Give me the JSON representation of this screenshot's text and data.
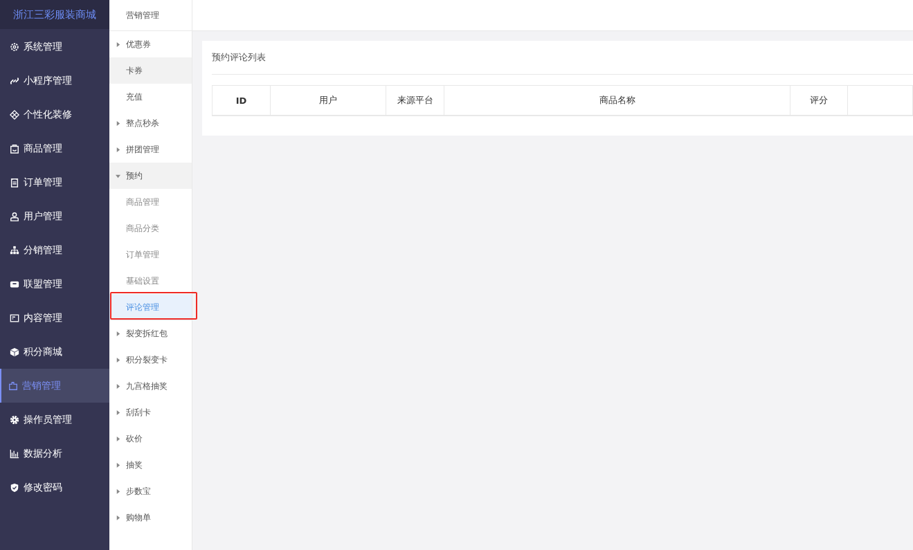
{
  "brand": "浙江三彩服装商城",
  "nav": [
    {
      "label": "系统管理",
      "selected": false
    },
    {
      "label": "小程序管理",
      "selected": false
    },
    {
      "label": "个性化装修",
      "selected": false
    },
    {
      "label": "商品管理",
      "selected": false
    },
    {
      "label": "订单管理",
      "selected": false
    },
    {
      "label": "用户管理",
      "selected": false
    },
    {
      "label": "分销管理",
      "selected": false
    },
    {
      "label": "联盟管理",
      "selected": false
    },
    {
      "label": "内容管理",
      "selected": false
    },
    {
      "label": "积分商城",
      "selected": false
    },
    {
      "label": "营销管理",
      "selected": true
    },
    {
      "label": "操作员管理",
      "selected": false
    },
    {
      "label": "数据分析",
      "selected": false
    },
    {
      "label": "修改密码",
      "selected": false
    }
  ],
  "submenu": {
    "title": "营销管理",
    "items": [
      {
        "kind": "group",
        "label": "优惠券",
        "expanded": false,
        "hovered": false
      },
      {
        "kind": "item",
        "label": "卡券",
        "selected": false,
        "hovered": true
      },
      {
        "kind": "item",
        "label": "充值",
        "selected": false,
        "hovered": false
      },
      {
        "kind": "group",
        "label": "整点秒杀",
        "expanded": false,
        "hovered": false
      },
      {
        "kind": "group",
        "label": "拼团管理",
        "expanded": false,
        "hovered": false
      },
      {
        "kind": "group",
        "label": "预约",
        "expanded": true,
        "hovered": false,
        "children": [
          {
            "label": "商品管理",
            "selected": false
          },
          {
            "label": "商品分类",
            "selected": false
          },
          {
            "label": "订单管理",
            "selected": false
          },
          {
            "label": "基础设置",
            "selected": false
          },
          {
            "label": "评论管理",
            "selected": true
          }
        ]
      },
      {
        "kind": "group",
        "label": "裂变拆红包",
        "expanded": false,
        "hovered": false
      },
      {
        "kind": "group",
        "label": "积分裂变卡",
        "expanded": false,
        "hovered": false
      },
      {
        "kind": "group",
        "label": "九宫格抽奖",
        "expanded": false,
        "hovered": false
      },
      {
        "kind": "group",
        "label": "刮刮卡",
        "expanded": false,
        "hovered": false
      },
      {
        "kind": "group",
        "label": "砍价",
        "expanded": false,
        "hovered": false
      },
      {
        "kind": "group",
        "label": "抽奖",
        "expanded": false,
        "hovered": false
      },
      {
        "kind": "group",
        "label": "步数宝",
        "expanded": false,
        "hovered": false
      },
      {
        "kind": "group",
        "label": "购物单",
        "expanded": false,
        "hovered": false
      }
    ]
  },
  "panel": {
    "title": "预约评论列表",
    "table": {
      "columns": [
        "ID",
        "用户",
        "来源平台",
        "商品名称",
        "评分"
      ]
    }
  }
}
